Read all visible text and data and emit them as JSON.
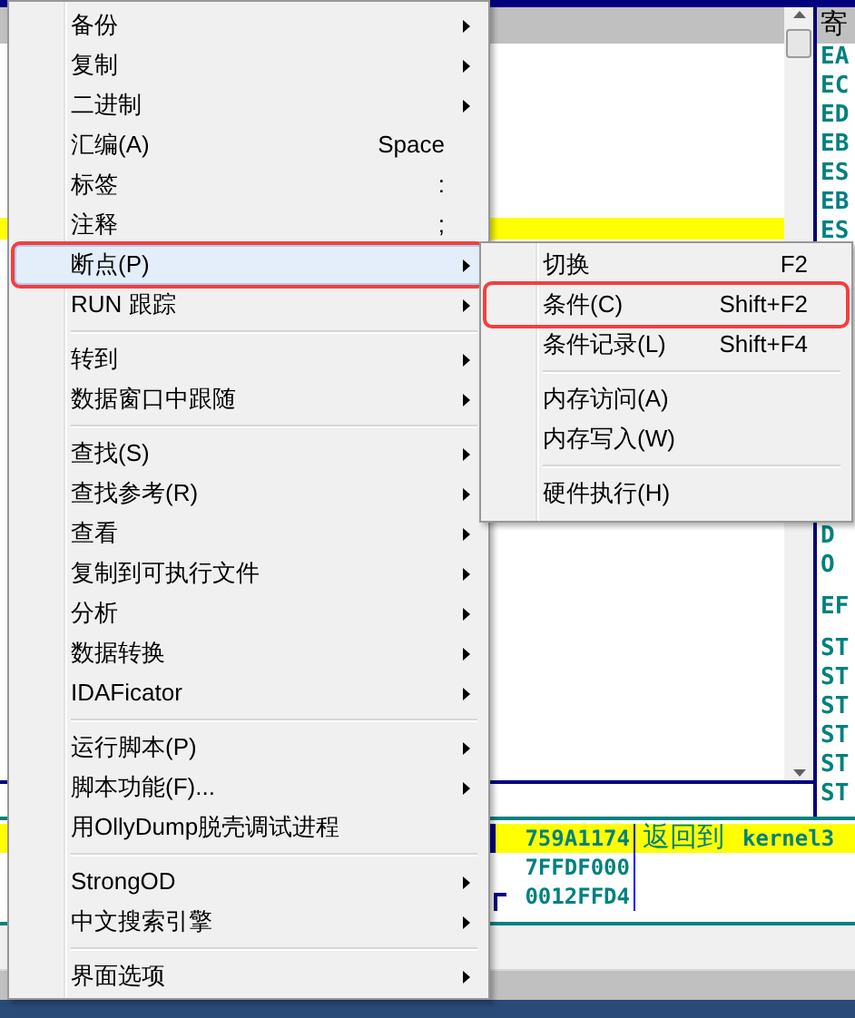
{
  "disassembly": {
    "rows": [
      {
        "selected": false
      },
      {
        "selected": false
      },
      {
        "selected": false
      },
      {
        "selected": false
      },
      {
        "selected": false
      },
      {
        "selected": false
      },
      {
        "selected": false
      },
      {
        "selected": false
      },
      {
        "selected": true
      }
    ]
  },
  "registers": {
    "header": "寄",
    "top_lines": [
      "EA",
      "EC",
      "ED",
      "EB",
      "ES",
      "EB",
      "ES"
    ],
    "bottom_groups": [
      [
        "D",
        "O"
      ],
      [
        "EF"
      ],
      [
        "ST",
        "ST",
        "ST",
        "ST",
        "ST",
        "ST"
      ]
    ]
  },
  "stack": {
    "rows": [
      {
        "address": "759A1174",
        "comment_label": "返回到",
        "comment_target": "kernel3",
        "selected": true,
        "bracket": false
      },
      {
        "address": "7FFDF000",
        "selected": false,
        "bracket": false
      },
      {
        "address": "0012FFD4",
        "selected": false,
        "bracket": true
      }
    ]
  },
  "context_menu": {
    "items": [
      {
        "kind": "item",
        "label": "备份",
        "submenu": true,
        "selected": false,
        "annotated": false
      },
      {
        "kind": "item",
        "label": "复制",
        "submenu": true,
        "selected": false,
        "annotated": false
      },
      {
        "kind": "item",
        "label": "二进制",
        "submenu": true,
        "selected": false,
        "annotated": false
      },
      {
        "kind": "item",
        "label": "汇编(A)",
        "shortcut": "Space",
        "submenu": false,
        "selected": false,
        "annotated": false
      },
      {
        "kind": "item",
        "label": "标签",
        "shortcut": ":",
        "submenu": false,
        "selected": false,
        "annotated": false
      },
      {
        "kind": "item",
        "label": "注释",
        "shortcut": ";",
        "submenu": false,
        "selected": false,
        "annotated": false
      },
      {
        "kind": "item",
        "label": "断点(P)",
        "submenu": true,
        "selected": true,
        "annotated": true
      },
      {
        "kind": "item",
        "label": "RUN 跟踪",
        "submenu": true,
        "selected": false,
        "annotated": false
      },
      {
        "kind": "separator"
      },
      {
        "kind": "item",
        "label": "转到",
        "submenu": true,
        "selected": false,
        "annotated": false
      },
      {
        "kind": "item",
        "label": "数据窗口中跟随",
        "submenu": true,
        "selected": false,
        "annotated": false
      },
      {
        "kind": "separator"
      },
      {
        "kind": "item",
        "label": "查找(S)",
        "submenu": true,
        "selected": false,
        "annotated": false
      },
      {
        "kind": "item",
        "label": "查找参考(R)",
        "submenu": true,
        "selected": false,
        "annotated": false
      },
      {
        "kind": "item",
        "label": "查看",
        "submenu": true,
        "selected": false,
        "annotated": false
      },
      {
        "kind": "item",
        "label": "复制到可执行文件",
        "submenu": true,
        "selected": false,
        "annotated": false
      },
      {
        "kind": "item",
        "label": "分析",
        "submenu": true,
        "selected": false,
        "annotated": false
      },
      {
        "kind": "item",
        "label": "数据转换",
        "submenu": true,
        "selected": false,
        "annotated": false
      },
      {
        "kind": "item",
        "label": "IDAFicator",
        "submenu": true,
        "selected": false,
        "annotated": false
      },
      {
        "kind": "separator"
      },
      {
        "kind": "item",
        "label": "运行脚本(P)",
        "submenu": true,
        "selected": false,
        "annotated": false
      },
      {
        "kind": "item",
        "label": "脚本功能(F)...",
        "submenu": true,
        "selected": false,
        "annotated": false
      },
      {
        "kind": "item",
        "label": "用OllyDump脱壳调试进程",
        "submenu": false,
        "selected": false,
        "annotated": false
      },
      {
        "kind": "separator"
      },
      {
        "kind": "item",
        "label": "StrongOD",
        "submenu": true,
        "selected": false,
        "annotated": false
      },
      {
        "kind": "item",
        "label": "中文搜索引擎",
        "submenu": true,
        "selected": false,
        "annotated": false
      },
      {
        "kind": "separator"
      },
      {
        "kind": "item",
        "label": "界面选项",
        "submenu": true,
        "selected": false,
        "annotated": false
      }
    ]
  },
  "submenu": {
    "items": [
      {
        "kind": "item",
        "label": "切换",
        "shortcut": "F2",
        "submenu": false,
        "selected": false,
        "annotated": false
      },
      {
        "kind": "item",
        "label": "条件(C)",
        "shortcut": "Shift+F2",
        "submenu": false,
        "selected": false,
        "annotated": true
      },
      {
        "kind": "item",
        "label": "条件记录(L)",
        "shortcut": "Shift+F4",
        "submenu": false,
        "selected": false,
        "annotated": false
      },
      {
        "kind": "separator"
      },
      {
        "kind": "item",
        "label": "内存访问(A)",
        "submenu": false,
        "selected": false,
        "annotated": false
      },
      {
        "kind": "item",
        "label": "内存写入(W)",
        "submenu": false,
        "selected": false,
        "annotated": false
      },
      {
        "kind": "separator"
      },
      {
        "kind": "item",
        "label": "硬件执行(H)",
        "submenu": false,
        "selected": false,
        "annotated": false
      }
    ]
  }
}
